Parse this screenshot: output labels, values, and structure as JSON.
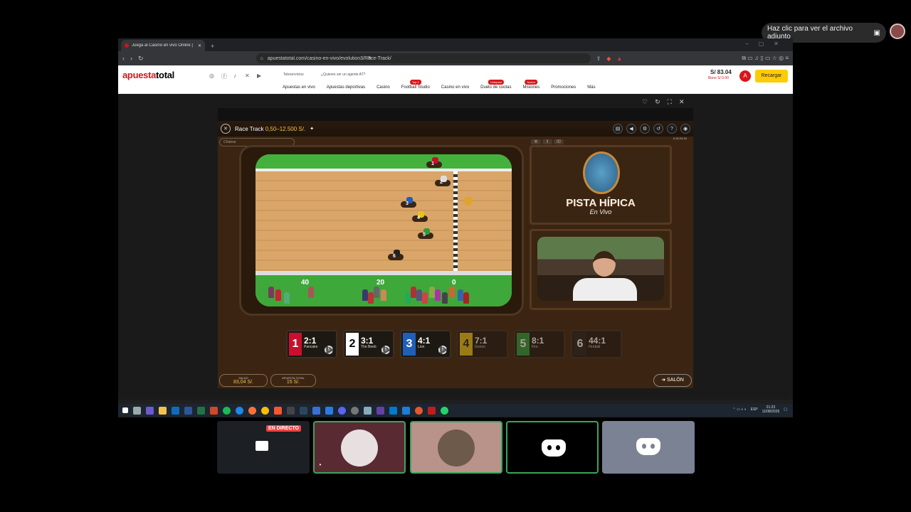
{
  "notification": {
    "text": "Haz clic para ver el archivo adjunto"
  },
  "browser": {
    "tab_title": "Juega al Casino en vivo Online |",
    "url": "apuestatotal.com/casino-en-vivo/evolution3/Race-Track/"
  },
  "site": {
    "logo_a": "apuesta",
    "logo_b": "total",
    "teleservicios": "Teleservicios",
    "agent_link": "¿Quieres ser un agente AT?",
    "nav": [
      {
        "label": "Apuestas en vivo",
        "badge": ""
      },
      {
        "label": "Apuestas deportivas",
        "badge": ""
      },
      {
        "label": "Casino",
        "badge": ""
      },
      {
        "label": "Football Studio",
        "badge": "Top 1"
      },
      {
        "label": "Casino en vivo",
        "badge": ""
      },
      {
        "label": "Duelo de cuotas",
        "badge": "Liverpool"
      },
      {
        "label": "Misiones",
        "badge": "Nuevo"
      },
      {
        "label": "Promociones",
        "badge": ""
      },
      {
        "label": "Más",
        "badge": ""
      }
    ],
    "balance": "S/ 83.04",
    "bonus": "Bono S/ 0.00",
    "account_initial": "A",
    "recharge": "Recargar"
  },
  "game": {
    "title": "Race Track",
    "limits": "0,50–12.500 S/.",
    "chat_placeholder": "Chatear",
    "game_id": "# 02:23:16",
    "distance_markers": [
      "40",
      "20",
      "0"
    ],
    "logo_title": "PISTA HÍPICA",
    "logo_sub": "En Vivo",
    "horses": [
      {
        "number": "1",
        "odds": "2:1",
        "name": "Pancake",
        "color": "#c8102e",
        "dim": false
      },
      {
        "number": "2",
        "odds": "3:1",
        "name": "The Beeb",
        "color": "#ffffff",
        "dim": false
      },
      {
        "number": "3",
        "odds": "4:1",
        "name": "Lion",
        "color": "#1f5fb8",
        "dim": false
      },
      {
        "number": "4",
        "odds": "7:1",
        "name": "Gonzo",
        "color": "#e8c21a",
        "dim": true
      },
      {
        "number": "5",
        "odds": "8:1",
        "name": "Fire",
        "color": "#2e9a3e",
        "dim": true
      },
      {
        "number": "6",
        "odds": "44:1",
        "name": "Fireball",
        "color": "#222222",
        "dim": true
      }
    ],
    "chip_value": "5",
    "saldo_label": "SALDO",
    "saldo_value": "83,04 S/.",
    "total_label": "APUESTA TOTAL",
    "total_value": "15 S/.",
    "salon": "SALÓN"
  },
  "taskbar": {
    "lang": "ESP",
    "time": "21:23",
    "date": "11/08/2025"
  },
  "call": {
    "live_label": "EN DIRECTO"
  }
}
